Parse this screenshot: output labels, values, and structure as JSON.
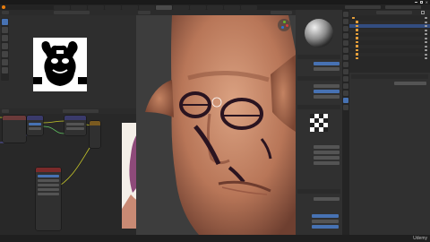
{
  "window": {
    "title": ""
  },
  "menu": {
    "items": [
      "",
      "",
      "",
      "",
      "",
      "",
      ""
    ]
  },
  "workspace_tabs": [
    "",
    "",
    "",
    "",
    "",
    "",
    "",
    "",
    "",
    "",
    "",
    ""
  ],
  "image_editor": {
    "header_labels": [
      "",
      "",
      ""
    ],
    "tools": [
      "cursor-icon",
      "brush-icon",
      "fill-icon",
      "smear-icon",
      "clone-icon",
      "mask-icon",
      "sample-icon"
    ]
  },
  "viewport": {
    "overlay_lines": [
      "",
      ""
    ]
  },
  "node_editor": {
    "header_labels": [
      "",
      "",
      ""
    ],
    "nodes": [
      {
        "title": "",
        "color": "#6b3a3a"
      },
      {
        "title": "",
        "color": "#3a3a6b"
      },
      {
        "title": "",
        "color": "#3a3a6b"
      },
      {
        "title": "",
        "color": "#7a5a20"
      },
      {
        "title": "",
        "color": "#7a2a2a"
      }
    ],
    "link_colors": [
      "#c7c729",
      "#63c763",
      "#6363c7"
    ]
  },
  "properties": {
    "sections": [
      "",
      "",
      "",
      "",
      ""
    ],
    "rows": [
      {
        "label": "",
        "value": ""
      },
      {
        "label": "",
        "value": ""
      },
      {
        "label": "",
        "value": ""
      },
      {
        "label": "",
        "value": ""
      },
      {
        "label": "",
        "value": ""
      },
      {
        "label": "",
        "value": ""
      },
      {
        "label": "",
        "value": ""
      },
      {
        "label": "",
        "value": ""
      },
      {
        "label": "",
        "value": ""
      },
      {
        "label": "",
        "value": ""
      }
    ]
  },
  "outliner": {
    "header": "",
    "items": [
      "",
      "",
      "",
      "",
      "",
      "",
      "",
      "",
      "",
      "",
      ""
    ]
  },
  "side_tabs": [
    "tool-icon",
    "render-icon",
    "output-icon",
    "view-layer-icon",
    "scene-icon",
    "world-icon",
    "object-icon",
    "modifier-icon",
    "particles-icon",
    "physics-icon",
    "constraints-icon",
    "data-icon",
    "material-icon",
    "texture-icon"
  ],
  "status_bar": {
    "left": "",
    "right": ""
  },
  "watermark": "Udemy",
  "colors": {
    "accent": "#4772b3",
    "panel_bg": "#303030",
    "header_bg": "#2b2b2b",
    "viewport_bg": "#3d3d3d",
    "skin": "#c78a6a"
  }
}
